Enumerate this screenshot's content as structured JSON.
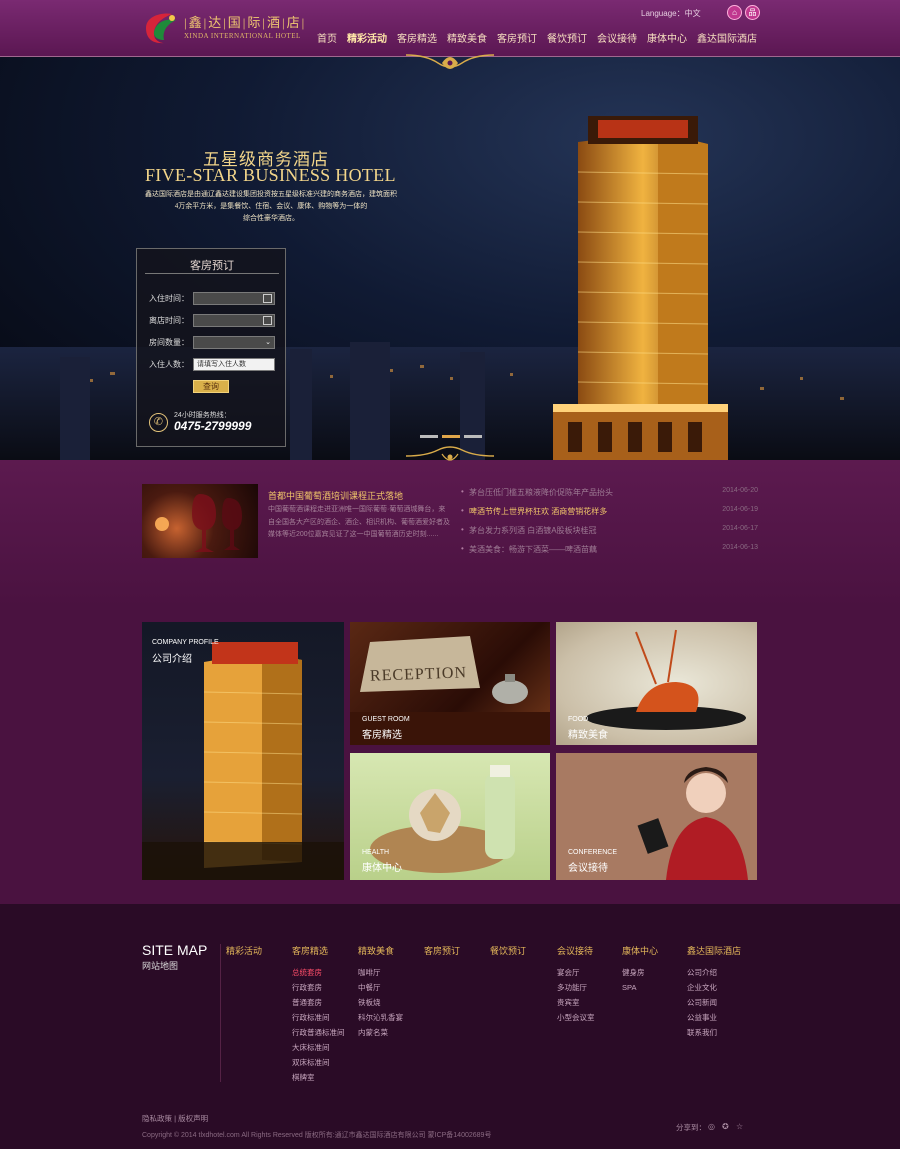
{
  "header": {
    "logo_cn": "|鑫|达|国|际|酒|店|",
    "logo_en": "XINDA INTERNATIONAL HOTEL",
    "language_label": "Language：中文",
    "icons": [
      "home-icon",
      "sitemap-icon"
    ],
    "nav": [
      "首页",
      "精彩活动",
      "客房精选",
      "精致美食",
      "客房预订",
      "餐饮预订",
      "会议接待",
      "康体中心",
      "鑫达国际酒店"
    ],
    "nav_active": 1
  },
  "hero": {
    "title_cn": "五星级商务酒店",
    "title_en": "FIVE-STAR BUSINESS HOTEL",
    "desc_line1": "鑫达国际酒店是由通辽鑫达建设集团投资按五星级标准兴建的商务酒店，建筑面积",
    "desc_line2": "4万余平方米，是集餐饮、住宿、会议、康体、购物等为一体的",
    "desc_line3": "综合性豪华酒店。",
    "slide_count": 3,
    "slide_active": 1
  },
  "booking": {
    "title": "客房预订",
    "checkin_label": "入住时间：",
    "checkout_label": "离店时间：",
    "rooms_label": "房间数量：",
    "guests_label": "入住人数：",
    "guests_placeholder": "请填写入住人数",
    "submit": "查询",
    "hotline_label": "24小时服务热线：",
    "hotline": "0475-2799999"
  },
  "news": {
    "featured_title": "首都中国葡萄酒培训课程正式落地",
    "featured_body": "中国葡萄酒课程走进亚洲唯一国际葡萄·葡萄酒城舞台，来自全国各大产区的酒企、酒企、相识机构、葡萄酒爱好者及媒体等近200位嘉宾见证了这一中国葡萄酒历史时刻......",
    "items": [
      {
        "title": "茅台压低门槛五粮液降价促陈年产品抬头",
        "date": "2014-06-20",
        "highlight": false
      },
      {
        "title": "啤酒节传上世界杯狂欢 酒商营销花样多",
        "date": "2014-06-19",
        "highlight": true
      },
      {
        "title": "茅台发力系列酒 白酒镀A股板块桂冠",
        "date": "2014-06-17",
        "highlight": false
      },
      {
        "title": "美酒美食：畅游下酒菜——啤酒苗藕",
        "date": "2014-06-13",
        "highlight": false
      }
    ]
  },
  "tiles": {
    "company": {
      "en": "COMPANY PROFILE",
      "cn": "公司介绍"
    },
    "room": {
      "en": "GUEST ROOM",
      "cn": "客房精选",
      "sign": "RECEPTION"
    },
    "food": {
      "en": "FOOD",
      "cn": "精致美食"
    },
    "health": {
      "en": "HEALTH",
      "cn": "康体中心"
    },
    "conference": {
      "en": "CONFERENCE",
      "cn": "会议接待"
    }
  },
  "footer": {
    "sitemap_en": "SITE MAP",
    "sitemap_cn": "网站地图",
    "columns": [
      {
        "title": "精彩活动",
        "items": []
      },
      {
        "title": "客房精选",
        "items": [
          "总统套房",
          "行政套房",
          "普通套房",
          "行政标准间",
          "行政普通标准间",
          "大床标准间",
          "双床标准间",
          "棋牌室"
        ],
        "red_index": 0
      },
      {
        "title": "精致美食",
        "items": [
          "咖啡厅",
          "中餐厅",
          "铁板烧",
          "科尔沁乳香宴",
          "内蒙名菜"
        ]
      },
      {
        "title": "客房预订",
        "items": []
      },
      {
        "title": "餐饮预订",
        "items": []
      },
      {
        "title": "会议接待",
        "items": [
          "宴会厅",
          "多功能厅",
          "贵宾室",
          "小型会议室"
        ]
      },
      {
        "title": "康体中心",
        "items": [
          "健身房",
          "SPA"
        ]
      },
      {
        "title": "鑫达国际酒店",
        "items": [
          "公司介绍",
          "企业文化",
          "公司新闻",
          "公益事业",
          "联系我们"
        ]
      }
    ],
    "legal": "隐私政策 | 版权声明",
    "copyright": "Copyright © 2014 tlxdhotel.com All Rights Reserved  版权所有:通辽市鑫达国际酒店有限公司  蒙ICP备14002689号",
    "share_label": "分享到：",
    "share_icons": [
      "weibo-icon",
      "qzone-icon",
      "star-icon"
    ]
  },
  "colors": {
    "purple_dark": "#4a1240",
    "purple_header": "#6a2161",
    "gold": "#f1c66a",
    "night_sky": "#0b1020"
  }
}
